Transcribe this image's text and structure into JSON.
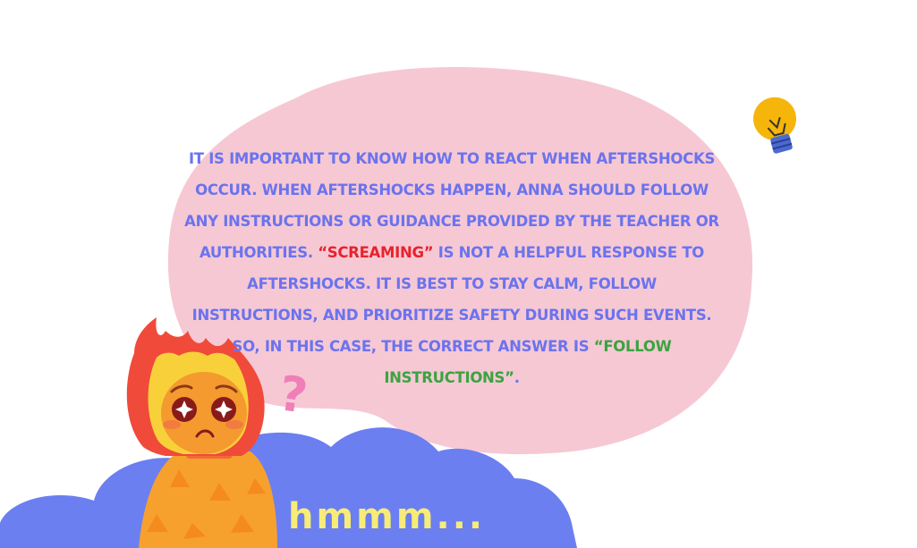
{
  "message": {
    "part1": "It is important to know how to react when aftershocks occur. When aftershocks happen, Anna should follow any instructions or guidance provided by the teacher or authorities. ",
    "wrong_answer": "“Screaming”",
    "part2": " is not a helpful response to aftershocks. It is best to stay calm, follow instructions, and prioritize safety during such events. So, in this case, the correct answer is ",
    "right_answer": "“Follow instructions”",
    "part3": "."
  },
  "thinking_text": "hmmm...",
  "question_mark": "?",
  "colors": {
    "bubble": "#f6c8d4",
    "cloud": "#6b7ff0",
    "text": "#6b73ee",
    "wrong": "#e8222c",
    "right": "#3aa43f",
    "hmmm": "#f7ec78",
    "bulb": "#f5b50a"
  },
  "icons": [
    "lightbulb-icon"
  ]
}
